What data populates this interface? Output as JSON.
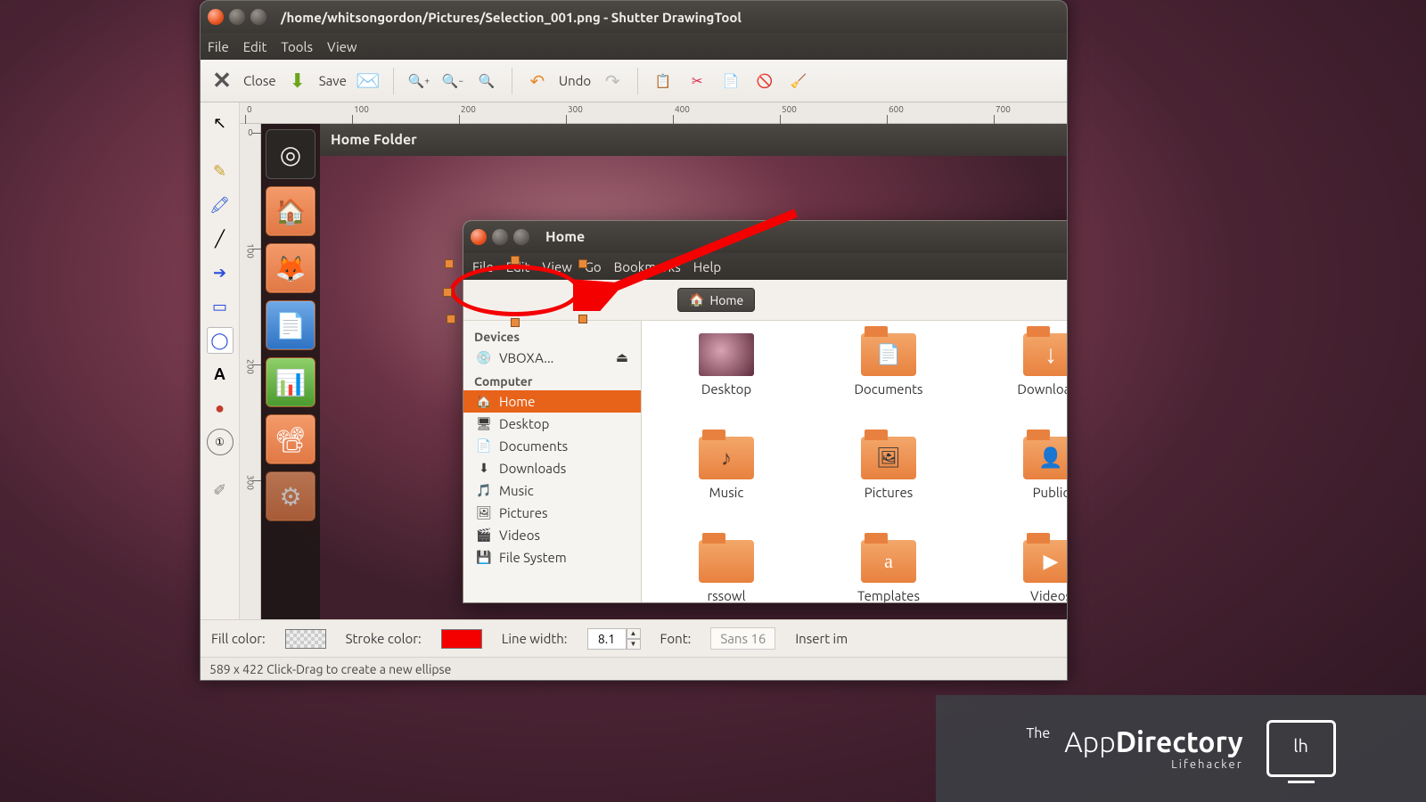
{
  "window": {
    "title": "/home/whitsongordon/Pictures/Selection_001.png - Shutter DrawingTool",
    "menus": [
      "File",
      "Edit",
      "Tools",
      "View"
    ],
    "ruler_marks": [
      "0",
      "100",
      "200",
      "300",
      "400",
      "500",
      "600",
      "700"
    ],
    "ruler_v_marks": [
      "0",
      "100",
      "200",
      "300"
    ]
  },
  "toolbar": {
    "close": "Close",
    "save": "Save",
    "undo": "Undo"
  },
  "home_panel": "Home Folder",
  "nautilus": {
    "title": "Home",
    "menus": [
      "File",
      "Edit",
      "View",
      "Go",
      "Bookmarks",
      "Help"
    ],
    "path_button": "Home",
    "sidebar": {
      "devices_head": "Devices",
      "device": "VBOXA...",
      "computer_head": "Computer",
      "items": [
        "Home",
        "Desktop",
        "Documents",
        "Downloads",
        "Music",
        "Pictures",
        "Videos",
        "File System"
      ]
    },
    "grid": [
      "Desktop",
      "Documents",
      "Downloads",
      "Music",
      "Pictures",
      "Public",
      "rssowl",
      "Templates",
      "Videos"
    ]
  },
  "options": {
    "fill_label": "Fill color:",
    "stroke_label": "Stroke color:",
    "linew_label": "Line width:",
    "linew_value": "8.1",
    "font_label": "Font:",
    "font_value": "Sans  16",
    "insert_label": "Insert im"
  },
  "status": "589 x 422 Click-Drag to create a new ellipse",
  "watermark": {
    "the": "The",
    "main1": "App",
    "main2": "Directory",
    "sub": "Lifehacker"
  }
}
